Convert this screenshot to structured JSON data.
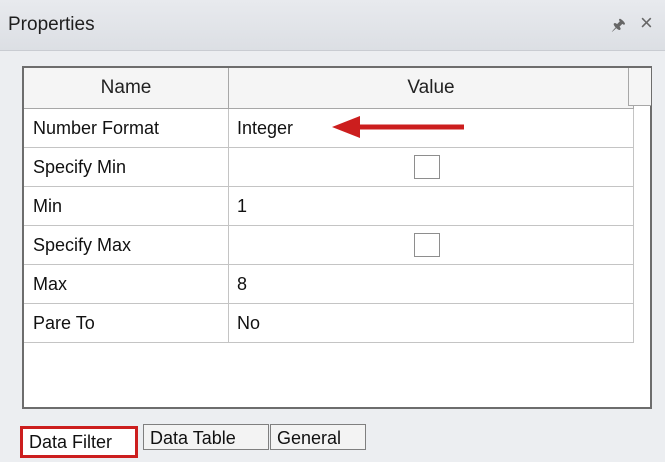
{
  "window": {
    "title": "Properties",
    "pin_icon": "pin-icon",
    "close_icon": "close-icon"
  },
  "grid": {
    "headers": {
      "name": "Name",
      "value": "Value"
    },
    "rows": [
      {
        "name": "Number Format",
        "value": "Integer"
      },
      {
        "name": "Specify Min",
        "value": ""
      },
      {
        "name": "Min",
        "value": "1"
      },
      {
        "name": "Specify Max",
        "value": ""
      },
      {
        "name": "Max",
        "value": "8"
      },
      {
        "name": "Pare To",
        "value": "No"
      }
    ]
  },
  "annotation": {
    "arrow_color": "#cc1e1e"
  },
  "tabs": [
    {
      "label": "Data Filter",
      "active": true
    },
    {
      "label": "Data Table",
      "active": false
    },
    {
      "label": "General",
      "active": false
    }
  ]
}
